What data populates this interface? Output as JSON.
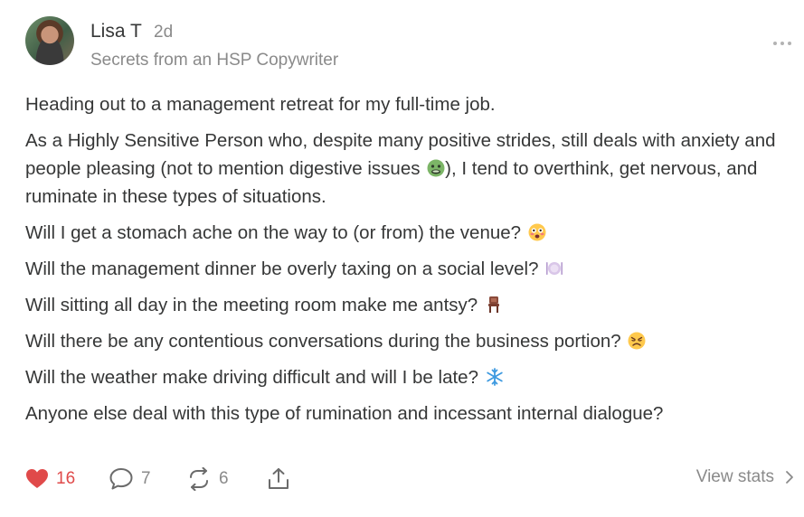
{
  "author": {
    "name": "Lisa T",
    "time": "2d",
    "publication": "Secrets from an HSP Copywriter"
  },
  "post": {
    "paragraphs": [
      {
        "text": "Heading out to a management retreat for my full-time job."
      },
      {
        "text_before": "As a Highly Sensitive Person who, despite many positive strides, still deals with anxiety and people pleasing (not to mention digestive issues ",
        "emoji": "nauseated-face-emoji",
        "text_after": "), I tend to overthink, get nervous, and ruminate in these types of situations."
      },
      {
        "text": "Will I get a stomach ache on the way to (or from) the venue? ",
        "emoji": "flushed-face-emoji"
      },
      {
        "text": "Will the management dinner be overly taxing on a social level? ",
        "emoji": "fork-knife-plate-emoji"
      },
      {
        "text": "Will sitting all day in the meeting room make me antsy? ",
        "emoji": "chair-emoji"
      },
      {
        "text": "Will there be any contentious conversations during the business portion? ",
        "emoji": "confounded-face-emoji"
      },
      {
        "text": "Will the weather make driving difficult and will I be late? ",
        "emoji": "snowflake-emoji"
      },
      {
        "text": "Anyone else deal with this type of rumination and incessant internal dialogue?"
      }
    ]
  },
  "actions": {
    "likes": "16",
    "comments": "7",
    "restacks": "6",
    "view_stats_label": "View stats"
  },
  "colors": {
    "like_red": "#e04a4a",
    "muted_text": "#8a8a8a",
    "body_text": "#363737"
  }
}
